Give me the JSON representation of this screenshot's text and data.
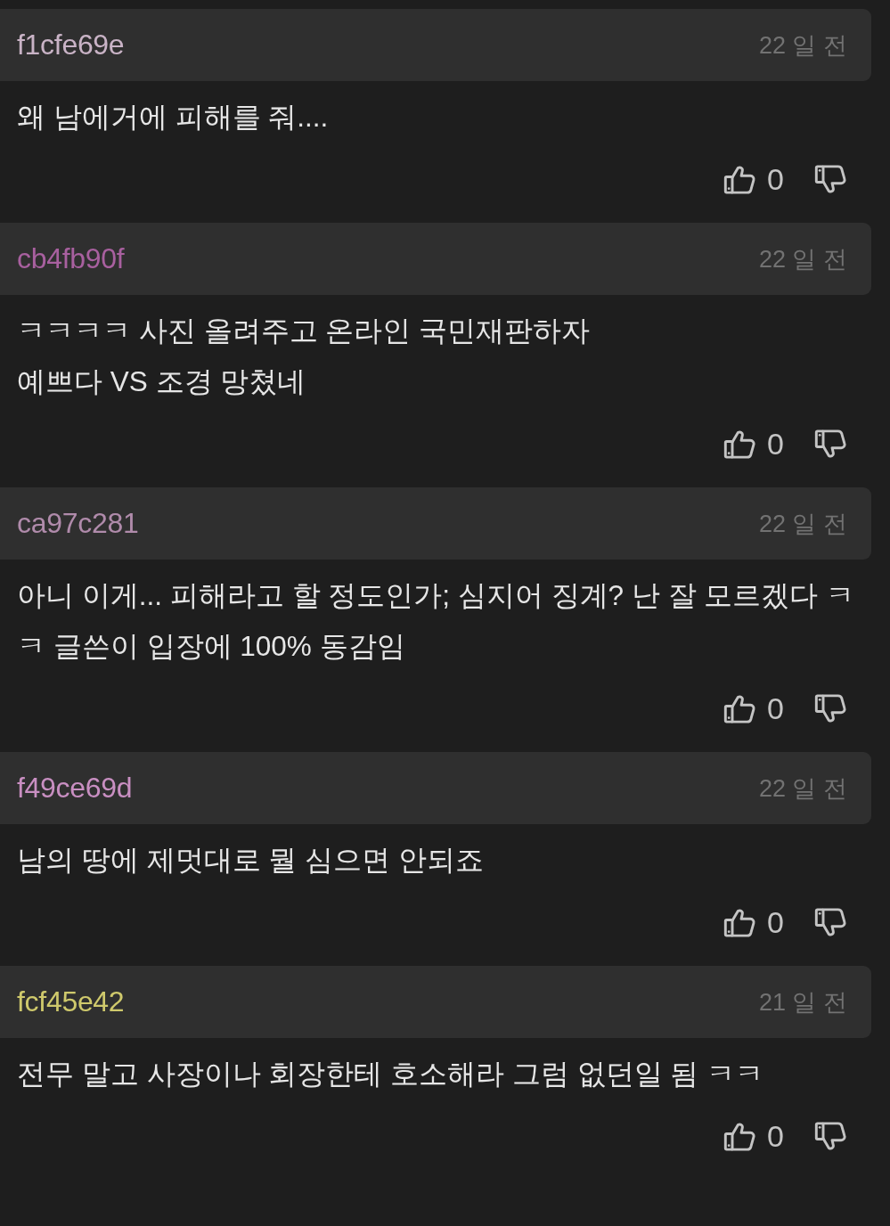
{
  "comments": [
    {
      "author": "f1cfe69e",
      "color": "#c9b3c6",
      "time": "22 일 전",
      "text": "왜 남에거에 피해를 줘....",
      "likes": "0"
    },
    {
      "author": "cb4fb90f",
      "color": "#a8609f",
      "time": "22 일 전",
      "text": "ㅋㅋㅋㅋ 사진 올려주고 온라인 국민재판하자\n예쁘다 VS 조경 망쳤네",
      "likes": "0"
    },
    {
      "author": "ca97c281",
      "color": "#b08bab",
      "time": "22 일 전",
      "text": "아니 이게... 피해라고 할 정도인가; 심지어 징계? 난 잘 모르겠다 ㅋㅋ 글쓴이 입장에 100% 동감임",
      "likes": "0"
    },
    {
      "author": "f49ce69d",
      "color": "#c98fc2",
      "time": "22 일 전",
      "text": "남의 땅에 제멋대로 뭘 심으면 안되죠",
      "likes": "0"
    },
    {
      "author": "fcf45e42",
      "color": "#cfc96c",
      "time": "21 일 전",
      "text": "전무 말고 사장이나 회장한테 호소해라 그럼 없던일 됨 ㅋㅋ",
      "likes": "0"
    }
  ]
}
